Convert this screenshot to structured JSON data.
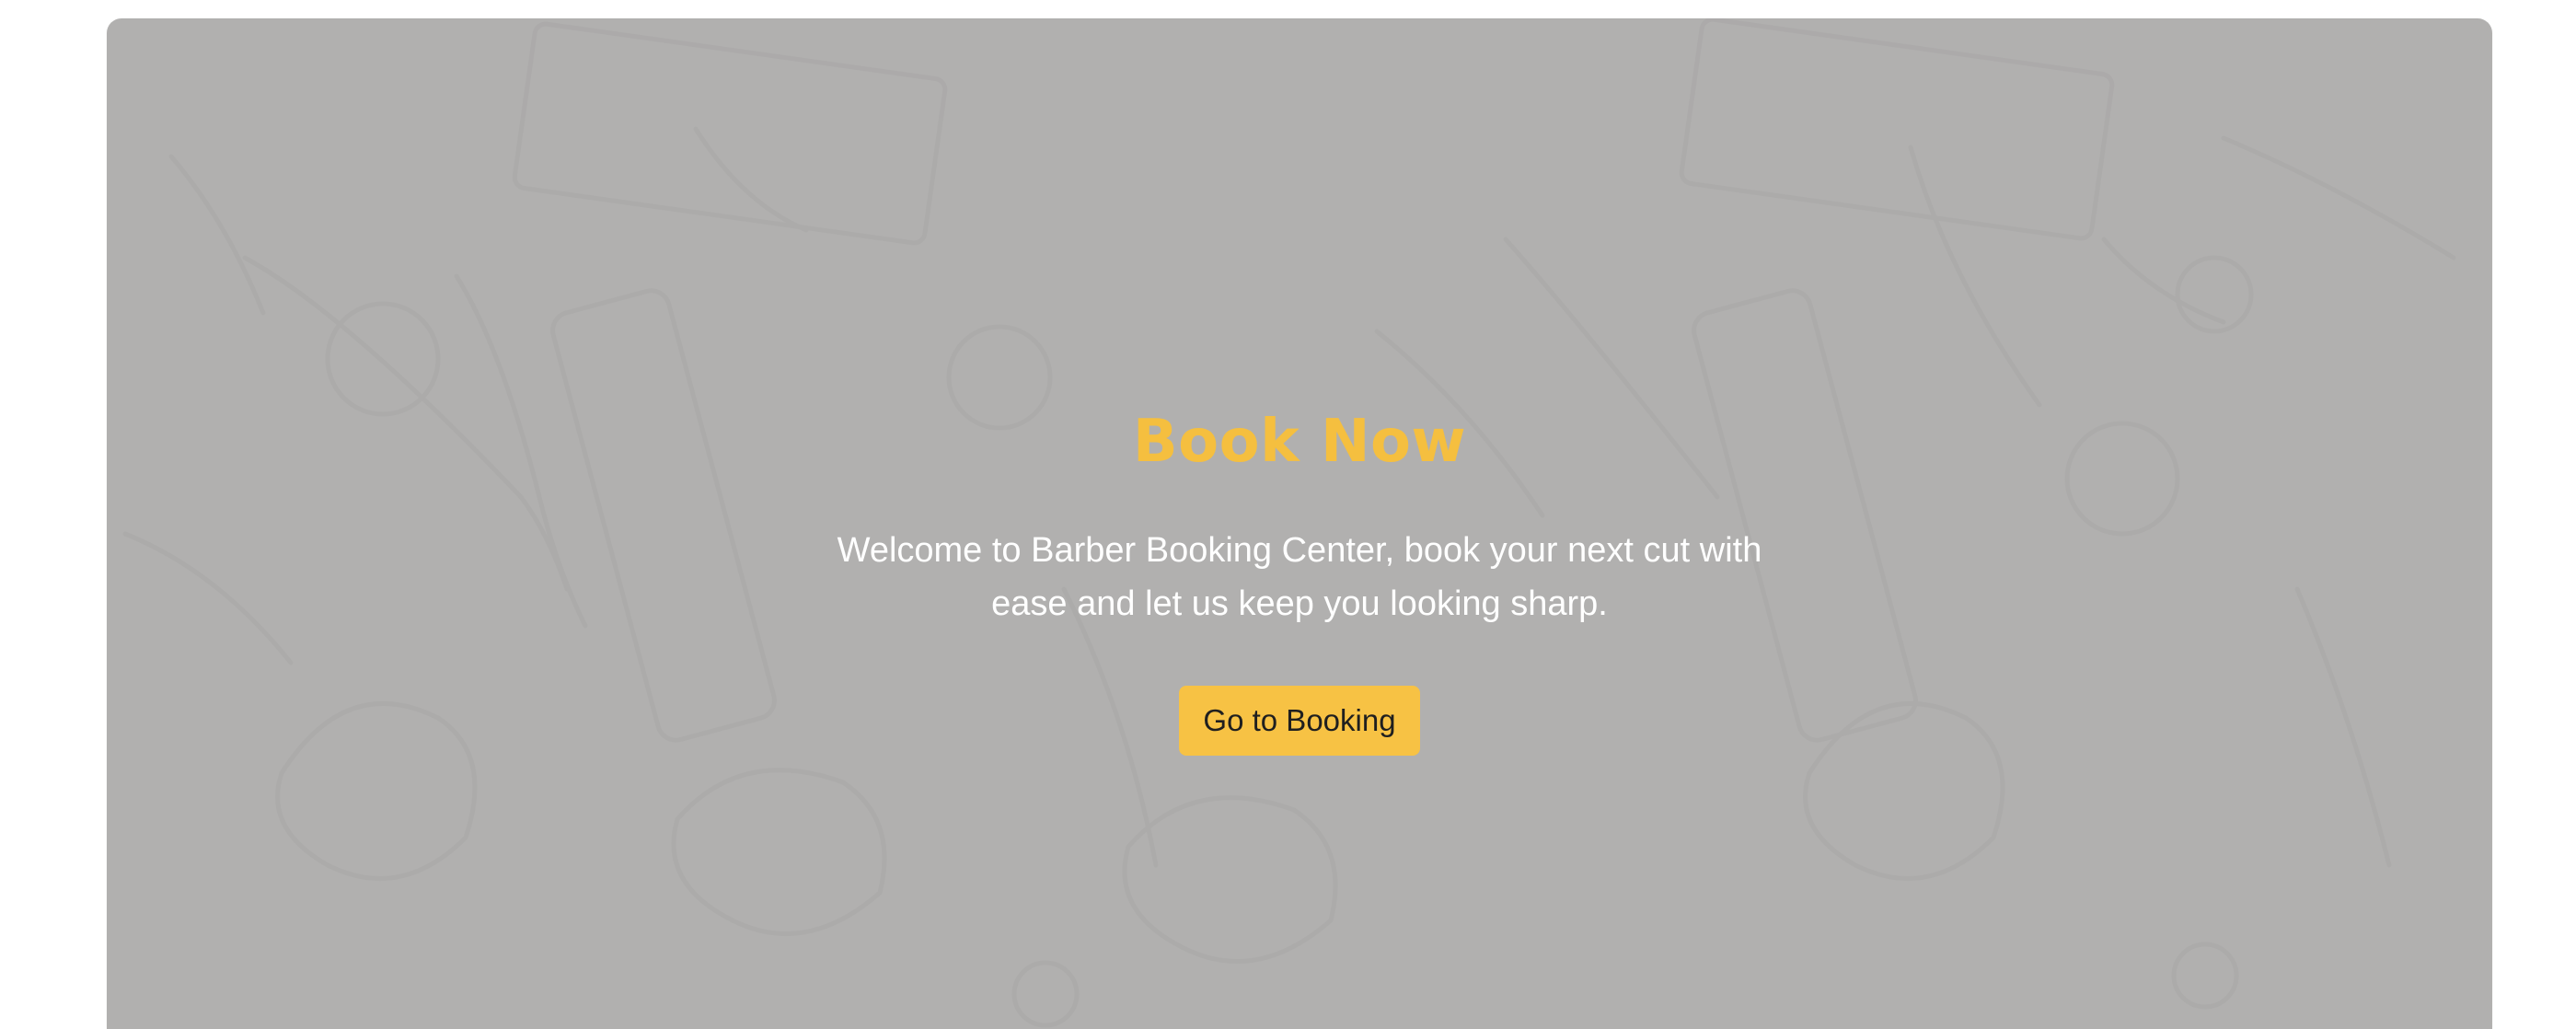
{
  "hero": {
    "title": "Book Now",
    "subtitle": "Welcome to Barber Booking Center, book your next cut with ease and let us keep you looking sharp.",
    "button_label": "Go to Booking",
    "background_pattern": "barber-tools-pattern"
  },
  "colors": {
    "accent": "#f5bf3f",
    "button": "#f7c244",
    "overlay": "#b1b0af",
    "text": "#ffffff"
  }
}
